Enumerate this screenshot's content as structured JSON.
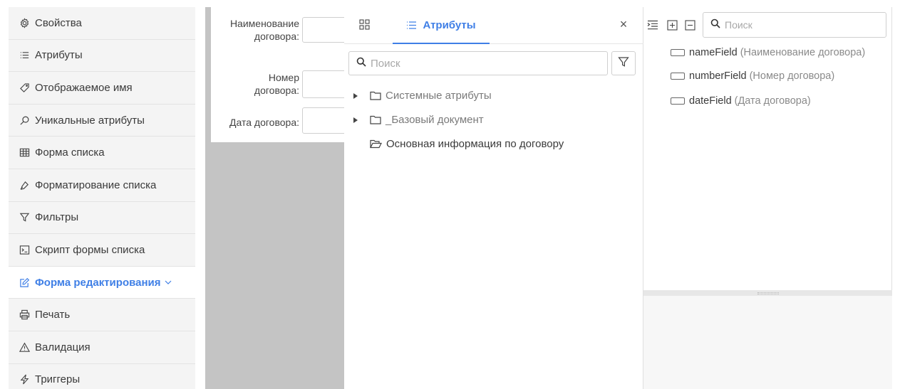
{
  "sidebar": {
    "items": [
      {
        "label": "Свойства",
        "icon": "gear-icon"
      },
      {
        "label": "Атрибуты",
        "icon": "list-icon"
      },
      {
        "label": "Отображаемое имя",
        "icon": "tag-icon"
      },
      {
        "label": "Уникальные атрибуты",
        "icon": "search-icon"
      },
      {
        "label": "Форма списка",
        "icon": "table-icon"
      },
      {
        "label": "Форматирование списка",
        "icon": "brush-icon"
      },
      {
        "label": "Фильтры",
        "icon": "filter-icon"
      },
      {
        "label": "Скрипт формы списка",
        "icon": "terminal-icon"
      },
      {
        "label": "Форма редактирования",
        "icon": "edit-icon",
        "active": true
      },
      {
        "label": "Печать",
        "icon": "printer-icon"
      },
      {
        "label": "Валидация",
        "icon": "warning-icon"
      },
      {
        "label": "Триггеры",
        "icon": "lightning-icon"
      }
    ]
  },
  "form_preview": {
    "fields": [
      {
        "label_line1": "Наименование",
        "label_line2": "договора:"
      },
      {
        "label_line1": "Номер",
        "label_line2": "договора:"
      },
      {
        "label_line1": "Дата договора:"
      }
    ]
  },
  "attributes_panel": {
    "tab_label": "Атрибуты",
    "close_label": "×",
    "search_placeholder": "Поиск",
    "tree": [
      {
        "label": "Системные атрибуты",
        "expandable": true
      },
      {
        "label": "_Базовый документ",
        "expandable": true
      },
      {
        "label": "Основная информация по договору",
        "expandable": false,
        "open": true
      }
    ]
  },
  "structure_panel": {
    "search_placeholder": "Поиск",
    "fields": [
      {
        "name": "nameField",
        "desc": "(Наименование договора)"
      },
      {
        "name": "numberField",
        "desc": "(Номер договора)"
      },
      {
        "name": "dateField",
        "desc": "(Дата договора)"
      }
    ]
  },
  "colors": {
    "accent": "#3f7fe6",
    "sidebar_bg": "#f4f4f4",
    "canvas_gray": "#c4c4c4"
  }
}
